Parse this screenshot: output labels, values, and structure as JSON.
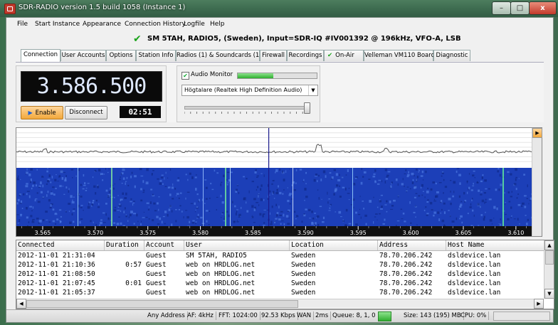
{
  "window": {
    "title": "SDR-RADIO version 1.5 build 1058 (Instance 1)",
    "minimize_glyph": "–",
    "maximize_glyph": "□",
    "close_glyph": "x"
  },
  "menu": [
    "File",
    "Start Instance",
    "Appearance",
    "Connection History",
    "Logfile",
    "Help"
  ],
  "status": {
    "text": "SM 5TAH, RADIO5, (Sweden), Input=SDR-IQ #IV001392 @ 196kHz, VFO-A, LSB",
    "check_color": "#1aa31a"
  },
  "tabs": [
    "Connection",
    "User Accounts",
    "Options",
    "Station Info",
    "Radios (1) & Soundcards (1)",
    "Firewall",
    "Recordings",
    "On-Air",
    "Velleman VM110 Board",
    "Diagnostic"
  ],
  "connection": {
    "frequency": "3.586.500",
    "enable_label": "Enable",
    "disconnect_label": "Disconnect",
    "timer": "02:51"
  },
  "audio": {
    "monitor_label": "Audio Monitor",
    "monitor_checked": true,
    "level_fraction": 0.45,
    "device": "Högtalare (Realtek High Definition Audio)",
    "volume_fraction": 0.98
  },
  "spectrum": {
    "freq_labels": [
      "3.565",
      "3.570",
      "3.575",
      "3.580",
      "3.585",
      "3.590",
      "3.595",
      "3.600",
      "3.605",
      "3.610"
    ],
    "marker_freq": 3.5865,
    "freq_min": 3.5625,
    "freq_max": 3.6115,
    "waterfall_base_color": "#1c3fb8",
    "trace_color": "#555555",
    "marker_color": "#1a1a8c"
  },
  "table": {
    "columns": [
      "Connected",
      "Duration",
      "Account",
      "User",
      "Location",
      "Address",
      "Host Name"
    ],
    "rows": [
      [
        "2012-11-01 21:31:04",
        "",
        "Guest",
        "SM 5TAH, RADIO5",
        "Sweden",
        "78.70.206.242",
        "dsldevice.lan"
      ],
      [
        "2012-11-01 21:10:36",
        "0:57",
        "Guest",
        "web on HRDLOG.net",
        "Sweden",
        "78.70.206.242",
        "dsldevice.lan"
      ],
      [
        "2012-11-01 21:08:50",
        "",
        "Guest",
        "web on HRDLOG.net",
        "Sweden",
        "78.70.206.242",
        "dsldevice.lan"
      ],
      [
        "2012-11-01 21:07:45",
        "0:01",
        "Guest",
        "web on HRDLOG.net",
        "Sweden",
        "78.70.206.242",
        "dsldevice.lan"
      ],
      [
        "2012-11-01 21:05:37",
        "",
        "Guest",
        "web on HRDLOG.net",
        "Sweden",
        "78.70.206.242",
        "dsldevice.lan"
      ]
    ]
  },
  "statusbar": {
    "address": "Any Address",
    "af": "AF: 4kHz",
    "fft": "FFT: 1024:00",
    "rate": "92.53 Kbps",
    "wan": "WAN",
    "latency": "2ms",
    "queue": "Queue: 8, 1, 0",
    "size": "Size: 143 (195) MB",
    "cpu": "CPU: 0%"
  }
}
